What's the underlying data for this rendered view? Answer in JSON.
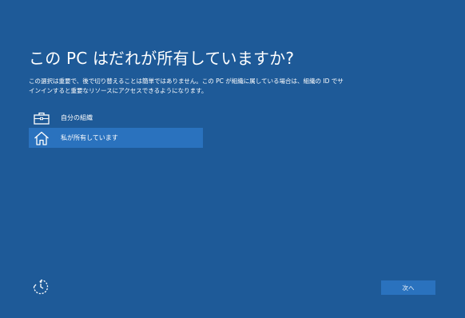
{
  "page": {
    "title": "この PC はだれが所有していますか?",
    "description_line1": "この選択は重要で、後で切り替えることは簡単ではありません。この PC が組織に属している場合は、組織の ID でサ",
    "description_line2": "インインすると重要なリソースにアクセスできるようになります。"
  },
  "options": [
    {
      "label": "自分の組織",
      "icon": "briefcase-icon",
      "selected": false
    },
    {
      "label": "私が所有しています",
      "icon": "home-icon",
      "selected": true
    }
  ],
  "footer": {
    "accessibility_icon": "ease-of-access-icon",
    "next_label": "次へ"
  },
  "colors": {
    "background": "#1e5a98",
    "selected": "#2a72be",
    "button": "#2a72be",
    "text": "#ffffff"
  }
}
